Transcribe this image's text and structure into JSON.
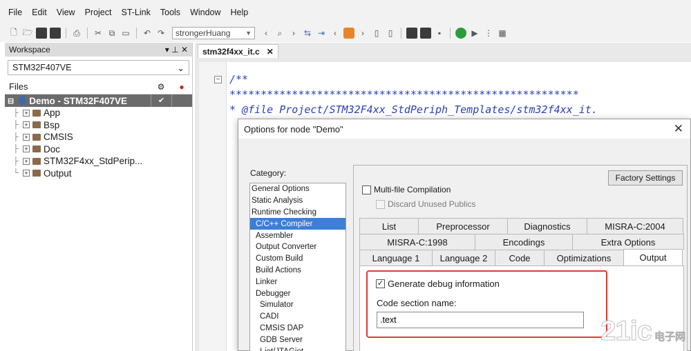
{
  "menu": [
    "File",
    "Edit",
    "View",
    "Project",
    "ST-Link",
    "Tools",
    "Window",
    "Help"
  ],
  "toolbar": {
    "combo_value": "strongerHuang"
  },
  "workspace": {
    "title": "Workspace",
    "pin": "▾  ⊥  ✕",
    "config": "STM32F407VE",
    "files_label": "Files",
    "root": {
      "label": "Demo - STM32F407VE",
      "check": "✔"
    },
    "items": [
      "App",
      "Bsp",
      "CMSIS",
      "Doc",
      "STM32F4xx_StdPerip...",
      "Output"
    ]
  },
  "editor": {
    "tab": "stm32f4xx_it.c",
    "lines": [
      "/**",
      "  ********************************************************",
      "  * @file    Project/STM32F4xx_StdPeriph_Templates/stm32f4xx_it."
    ]
  },
  "dialog": {
    "title": "Options for node \"Demo\"",
    "category_label": "Category:",
    "categories": [
      {
        "label": "General Options",
        "level": 0
      },
      {
        "label": "Static Analysis",
        "level": 0
      },
      {
        "label": "Runtime Checking",
        "level": 0
      },
      {
        "label": "C/C++ Compiler",
        "level": 1,
        "selected": true
      },
      {
        "label": "Assembler",
        "level": 1
      },
      {
        "label": "Output Converter",
        "level": 1
      },
      {
        "label": "Custom Build",
        "level": 1
      },
      {
        "label": "Build Actions",
        "level": 1
      },
      {
        "label": "Linker",
        "level": 1
      },
      {
        "label": "Debugger",
        "level": 1
      },
      {
        "label": "Simulator",
        "level": 2
      },
      {
        "label": "CADI",
        "level": 2
      },
      {
        "label": "CMSIS DAP",
        "level": 2
      },
      {
        "label": "GDB Server",
        "level": 2
      },
      {
        "label": "I-jet/JTAGjet",
        "level": 2
      }
    ],
    "factory_settings": "Factory Settings",
    "multi_file": "Multi-file Compilation",
    "discard_unused": "Discard Unused Publics",
    "tab_rows": [
      [
        "List",
        "Preprocessor",
        "Diagnostics",
        "MISRA-C:2004"
      ],
      [
        "MISRA-C:1998",
        "Encodings",
        "Extra Options"
      ],
      [
        "Language 1",
        "Language 2",
        "Code",
        "Optimizations",
        "Output"
      ]
    ],
    "active_tab": "Output",
    "generate_debug": "Generate debug information",
    "code_section_label": "Code section name:",
    "code_section_value": ".text"
  },
  "watermark": {
    "big": "21ic",
    "top": "电子网",
    "bottom": " "
  }
}
